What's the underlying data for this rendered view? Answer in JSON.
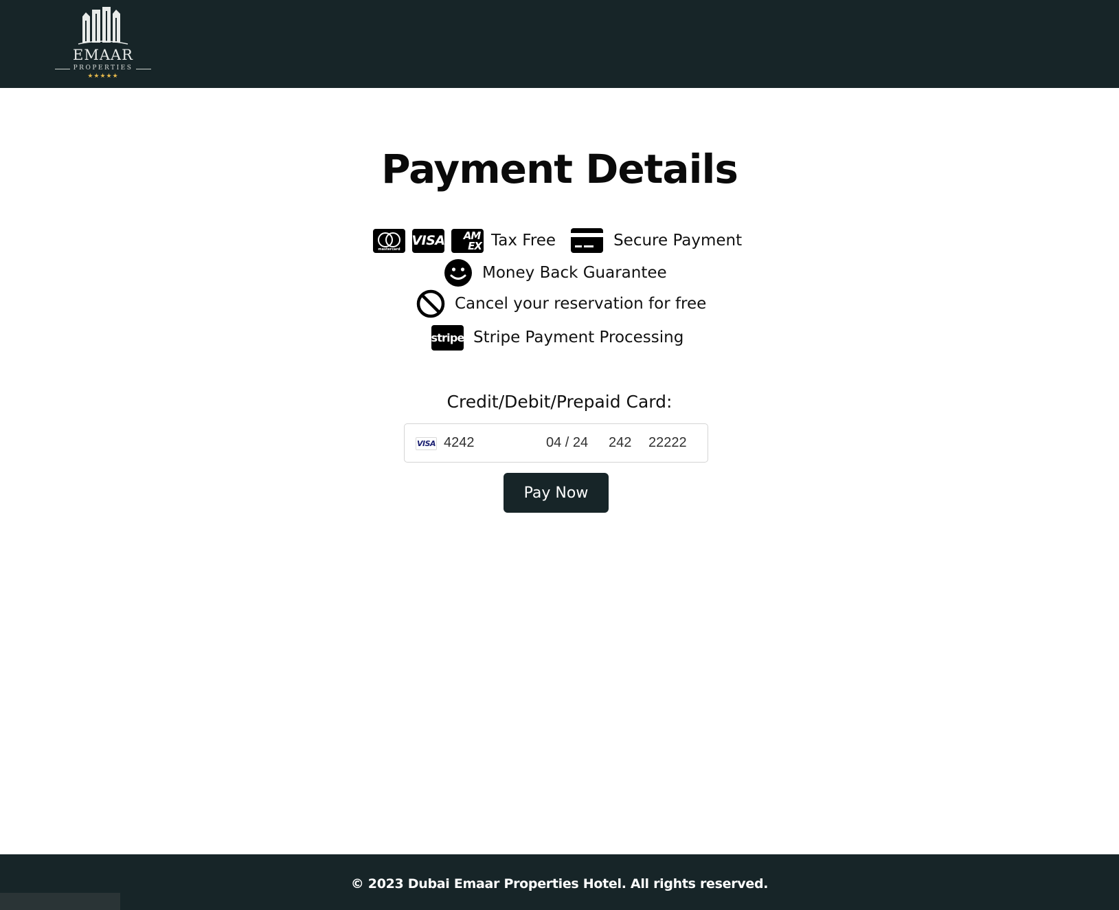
{
  "header": {
    "logo": {
      "name": "EMAAR",
      "subtitle": "PROPERTIES",
      "stars": "★★★★★"
    },
    "background_color": "#172528"
  },
  "page_title": "Payment Details",
  "features": {
    "card_brands": [
      "mastercard",
      "VISA",
      "AM EX"
    ],
    "tax_free": "Tax Free",
    "secure_payment": "Secure Payment",
    "money_back": "Money Back Guarantee",
    "cancel_free": "Cancel your reservation for free",
    "stripe_badge": "stripe",
    "stripe_processing": "Stripe Payment Processing",
    "icons": [
      "mastercard-icon",
      "visa-icon",
      "amex-icon",
      "credit-card-icon",
      "smiley-icon",
      "ban-icon",
      "stripe-icon"
    ]
  },
  "card_form": {
    "label": "Credit/Debit/Prepaid Card:",
    "brand": "VISA",
    "card_number": "4242",
    "expiry": "04 / 24",
    "cvc": "242",
    "zip": "22222"
  },
  "pay_button": {
    "label": "Pay Now",
    "color": "#172528"
  },
  "footer": {
    "text": "© 2023 Dubai Emaar Properties Hotel. All rights reserved."
  }
}
